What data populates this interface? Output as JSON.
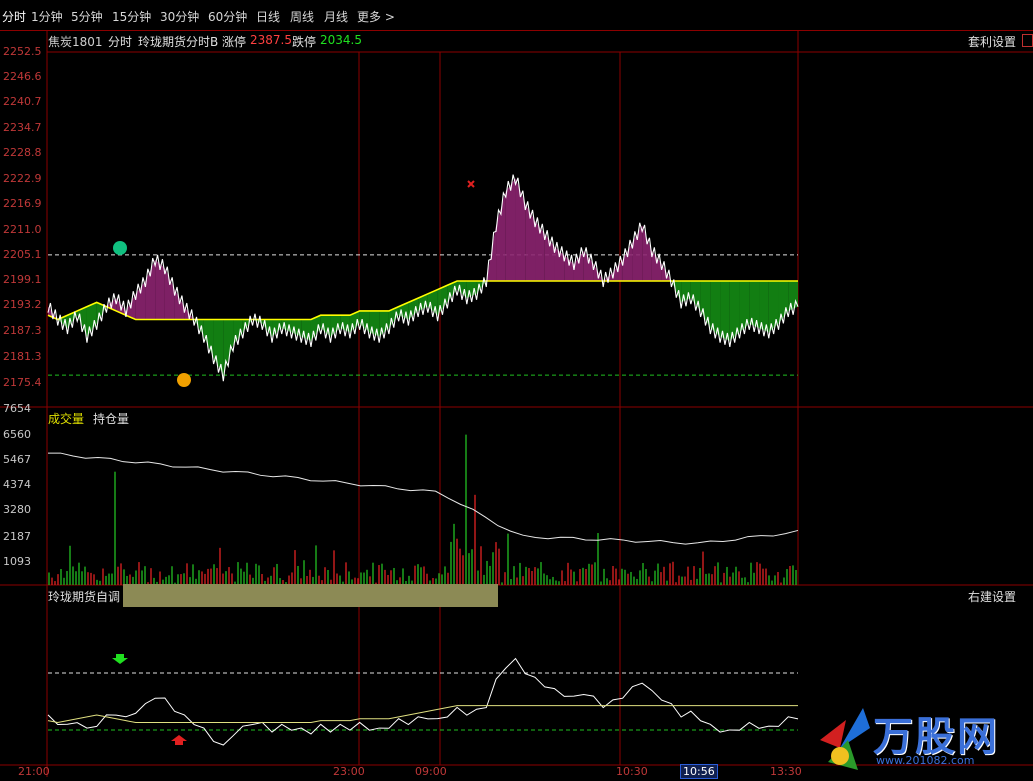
{
  "tabs": {
    "items": [
      {
        "label": "分时",
        "active": true
      },
      {
        "label": "1分钟"
      },
      {
        "label": "5分钟"
      },
      {
        "label": "15分钟"
      },
      {
        "label": "30分钟"
      },
      {
        "label": "60分钟"
      },
      {
        "label": "日线"
      },
      {
        "label": "周线"
      },
      {
        "label": "月线"
      },
      {
        "label": "更多 >"
      }
    ]
  },
  "header": {
    "symbol": "焦炭1801",
    "mode": "分时",
    "indicator": "玲珑期货分时B",
    "limit_up_label": "涨停",
    "limit_up_value": "2387.5",
    "limit_down_label": "跌停",
    "limit_down_value": "2034.5",
    "arb_settings": "套利设置"
  },
  "volume_panel": {
    "volume_label": "成交量",
    "oi_label": "持仓量"
  },
  "bottom_panel": {
    "title": "玲珑期货自调",
    "right_settings": "右建设置"
  },
  "price_axis": [
    "2252.5",
    "2246.6",
    "2240.7",
    "2234.7",
    "2228.8",
    "2222.9",
    "2216.9",
    "2211.0",
    "2205.1",
    "2199.1",
    "2193.2",
    "2187.3",
    "2181.3",
    "2175.4"
  ],
  "volume_axis": [
    "7654",
    "6560",
    "5467",
    "4374",
    "3280",
    "2187",
    "1093"
  ],
  "time_axis": [
    "21:00",
    "23:00",
    "09:00",
    "10:30",
    "10:56",
    "13:30"
  ],
  "logo": {
    "text": "万股网",
    "url_text": "www.201082.com"
  },
  "colors": {
    "up": "#ff3232",
    "down": "#00d200",
    "price_line": "#ffffff",
    "avg_line": "#ffff00",
    "grid": "#8c0000",
    "band_up": "#8c2470",
    "band_down": "#148c14"
  },
  "chart_data": {
    "type": "line",
    "ylim": [
      2175.4,
      2252.5
    ],
    "dashed_levels": [
      2205.1,
      2177.0
    ],
    "price_series": [
      2193,
      2190,
      2188,
      2191,
      2186,
      2189,
      2193,
      2195,
      2192,
      2196,
      2199,
      2204,
      2202,
      2197,
      2193,
      2190,
      2186,
      2181,
      2177,
      2184,
      2187,
      2190,
      2189,
      2186,
      2188,
      2187,
      2186,
      2185,
      2188,
      2186,
      2188,
      2187,
      2189,
      2187,
      2186,
      2188,
      2191,
      2190,
      2192,
      2193,
      2191,
      2194,
      2197,
      2195,
      2196,
      2199,
      2212,
      2220,
      2223,
      2217,
      2213,
      2210,
      2207,
      2205,
      2203,
      2206,
      2203,
      2199,
      2201,
      2204,
      2208,
      2212,
      2206,
      2203,
      2199,
      2194,
      2195,
      2192,
      2188,
      2186,
      2185,
      2187,
      2189,
      2188,
      2187,
      2189,
      2192,
      2193
    ],
    "avg_series": [
      2191,
      2190,
      2191,
      2192,
      2193,
      2194,
      2193,
      2192,
      2191,
      2190,
      2190,
      2190,
      2190,
      2190,
      2190,
      2190,
      2190,
      2190,
      2190,
      2190,
      2190,
      2190,
      2190,
      2190,
      2190,
      2190,
      2190,
      2190,
      2191,
      2191,
      2191,
      2191,
      2192,
      2192,
      2192,
      2192,
      2193,
      2194,
      2195,
      2196,
      2197,
      2198,
      2199,
      2199,
      2199,
      2199,
      2199,
      2199,
      2199,
      2199,
      2199,
      2199,
      2199,
      2199,
      2199,
      2199,
      2199,
      2199,
      2199,
      2199,
      2199,
      2199,
      2199,
      2199,
      2199,
      2199,
      2199,
      2199,
      2199,
      2199,
      2199,
      2199,
      2199,
      2199,
      2199,
      2199,
      2199,
      2199
    ],
    "volume_ylim": [
      0,
      7654
    ]
  }
}
